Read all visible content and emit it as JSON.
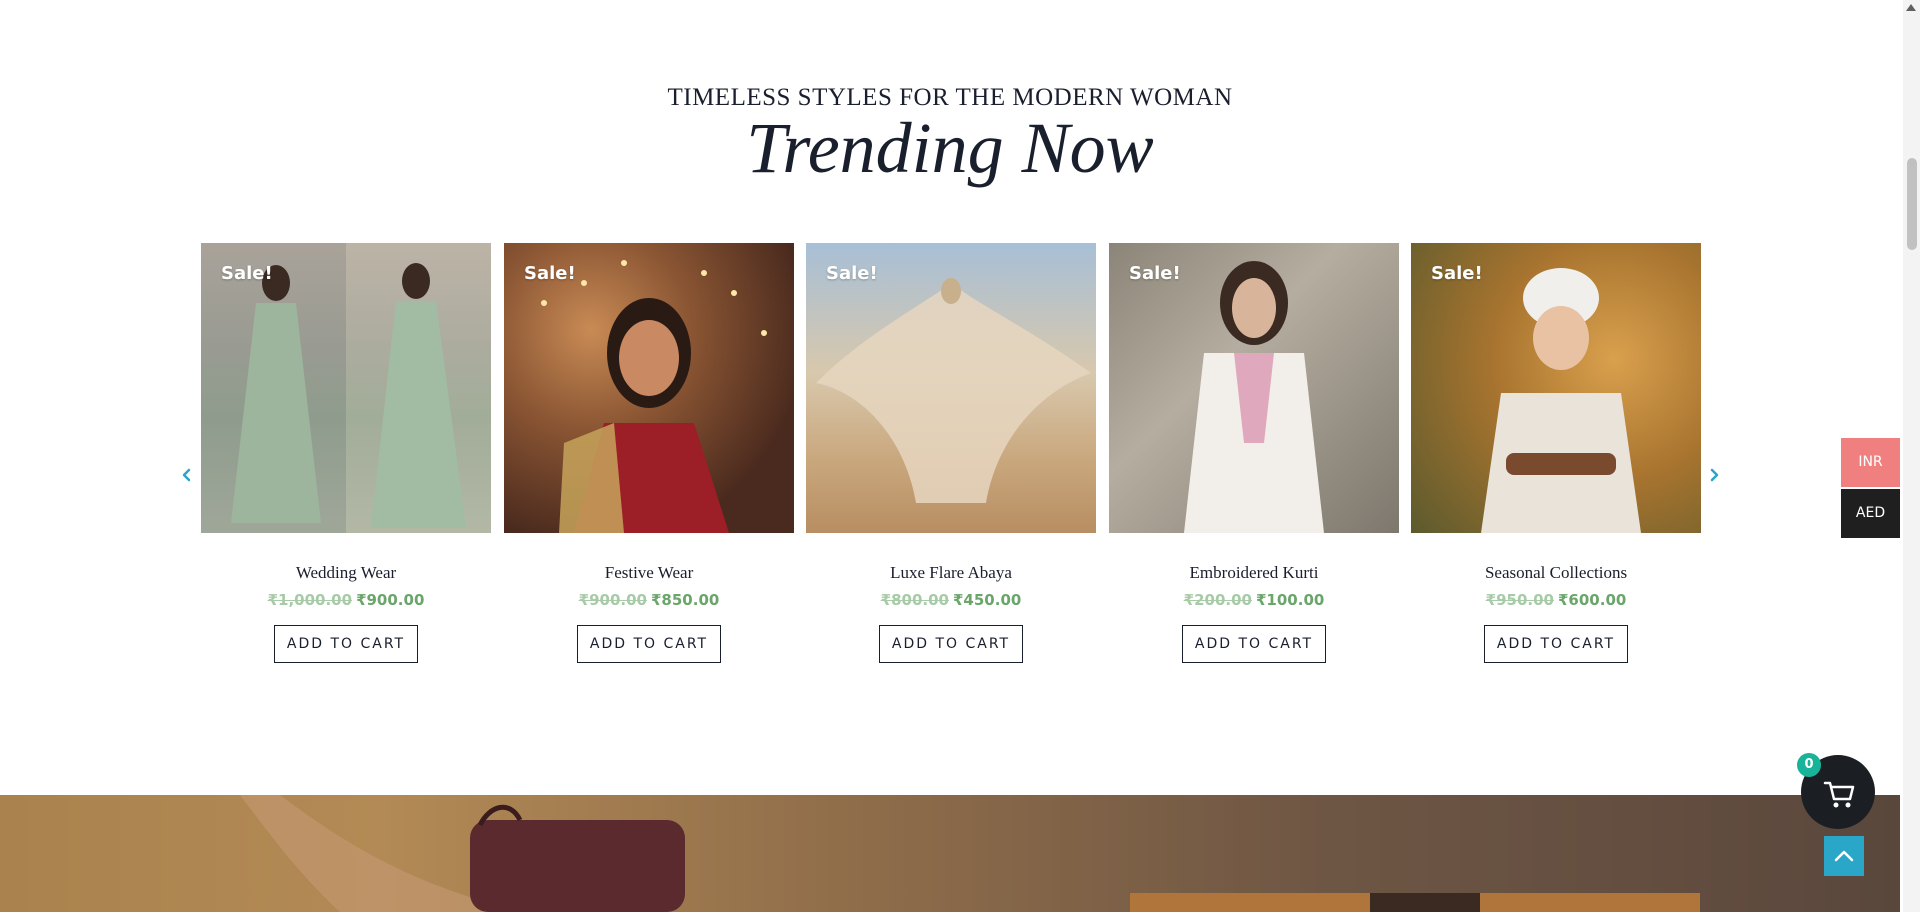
{
  "header": {
    "subtitle": "TIMELESS STYLES FOR THE MODERN WOMAN",
    "title": "Trending Now"
  },
  "products": [
    {
      "badge": "Sale!",
      "name": "Wedding Wear",
      "old_price": "₹1,000.00",
      "new_price": "₹900.00",
      "button": "ADD TO CART"
    },
    {
      "badge": "Sale!",
      "name": "Festive Wear",
      "old_price": "₹900.00",
      "new_price": "₹850.00",
      "button": "ADD TO CART"
    },
    {
      "badge": "Sale!",
      "name": "Luxe Flare Abaya",
      "old_price": "₹800.00",
      "new_price": "₹450.00",
      "button": "ADD TO CART"
    },
    {
      "badge": "Sale!",
      "name": "Embroidered Kurti",
      "old_price": "₹200.00",
      "new_price": "₹100.00",
      "button": "ADD TO CART"
    },
    {
      "badge": "Sale!",
      "name": "Seasonal Collections",
      "old_price": "₹950.00",
      "new_price": "₹600.00",
      "button": "ADD TO CART"
    }
  ],
  "currency": {
    "options": [
      "INR",
      "AED"
    ],
    "active": "INR",
    "active_color": "#f08080",
    "inactive_color": "#1f1f1f"
  },
  "cart": {
    "count": "0",
    "icon": "cart-icon"
  },
  "colors": {
    "accent": "#2aa7c8",
    "sale_price": "#6aa56a",
    "old_price": "#a7cba7",
    "text_dark": "#1a1f2e"
  }
}
